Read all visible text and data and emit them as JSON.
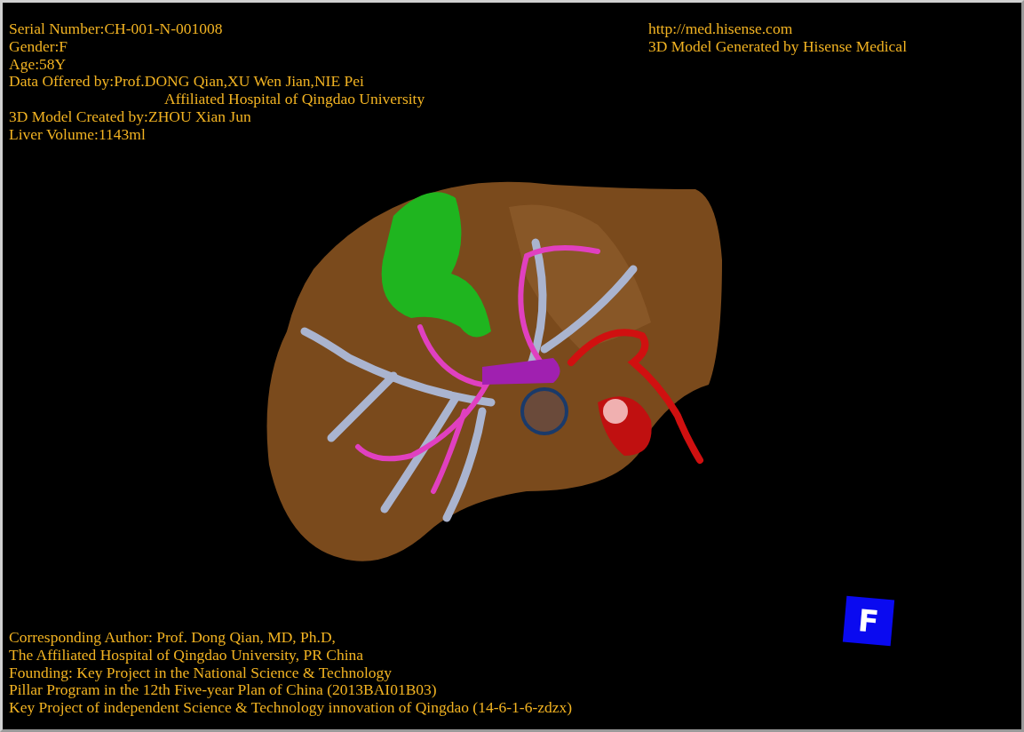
{
  "info": [
    {
      "text": "Serial Number:CH-001-N-001008",
      "kind": "line"
    },
    {
      "text": "Gender:F",
      "kind": "line"
    },
    {
      "text": "Age:58Y",
      "kind": "line"
    },
    {
      "text": "Data Offered by:Prof.DONG Qian,XU Wen Jian,NIE Pei",
      "kind": "line"
    },
    {
      "text": "Affiliated Hospital of Qingdao University",
      "kind": "continuation"
    },
    {
      "text": "3D Model Created by:ZHOU Xian Jun",
      "kind": "line"
    },
    {
      "text": "Liver Volume:1143ml",
      "kind": "line"
    }
  ],
  "credits": [
    {
      "text": "http://med.hisense.com",
      "kind": "line"
    },
    {
      "text": "3D Model Generated by Hisense Medical",
      "kind": "line"
    }
  ],
  "footer": [
    {
      "text": "Corresponding Author: Prof. Dong Qian, MD, Ph.D,",
      "kind": "line"
    },
    {
      "text": "The Affiliated Hospital of Qingdao University, PR China",
      "kind": "line"
    },
    {
      "text": "Founding: Key Project in the National Science & Technology",
      "kind": "line"
    },
    {
      "text": "Pillar Program in the 12th Five-year Plan of China (2013BAI01B03)",
      "kind": "line"
    },
    {
      "text": "Key Project of independent Science & Technology innovation of Qingdao (14-6-1-6-zdzx)",
      "kind": "line"
    }
  ],
  "orientation": {
    "label": "F"
  }
}
